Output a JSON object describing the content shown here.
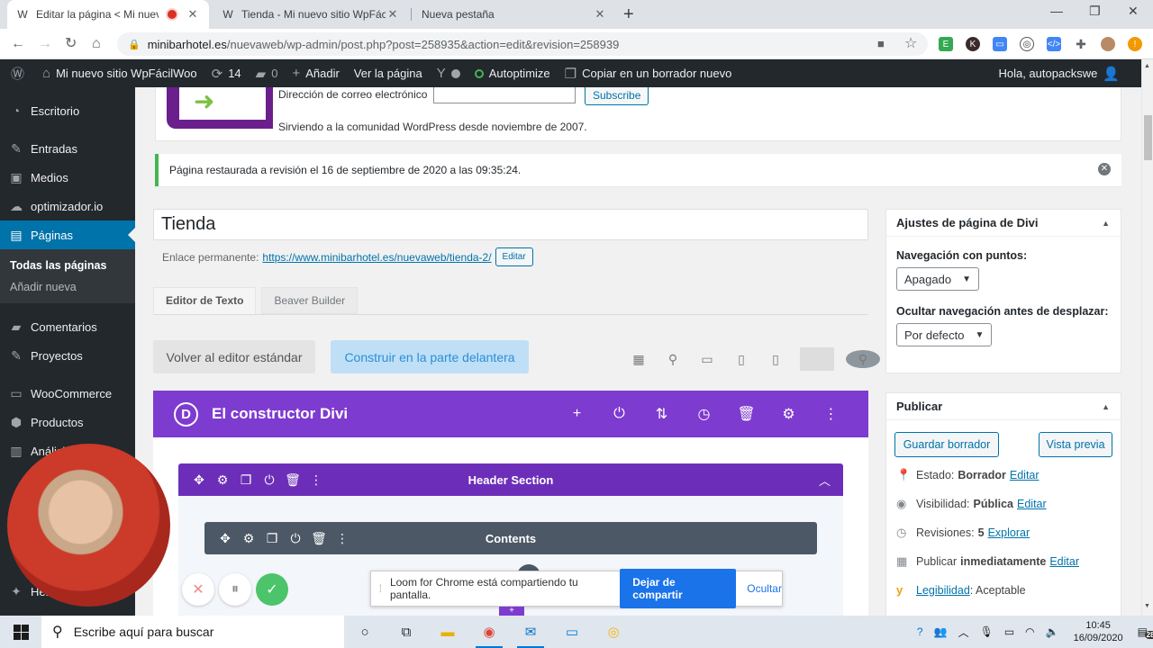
{
  "browser": {
    "tabs": [
      {
        "title": "Editar la página < Mi nuevo",
        "active": true
      },
      {
        "title": "Tienda - Mi nuevo sitio WpFácilW",
        "active": false
      },
      {
        "title": "Nueva pestaña",
        "active": false
      }
    ],
    "url_host": "minibarhotel.es",
    "url_path": "/nuevaweb/wp-admin/post.php?post=258935&action=edit&revision=258939"
  },
  "adminbar": {
    "site_name": "Mi nuevo sitio WpFácilWoo",
    "updates_count": "14",
    "comments_count": "0",
    "add_new": "Añadir",
    "view_page": "Ver la página",
    "autoptimize": "Autoptimize",
    "copy_draft": "Copiar en un borrador nuevo",
    "greeting": "Hola, autopackswe"
  },
  "sidebar": {
    "items": [
      {
        "label": "Escritorio",
        "icon": "dashboard-icon"
      },
      {
        "label": "Entradas",
        "icon": "pin-icon"
      },
      {
        "label": "Medios",
        "icon": "media-icon"
      },
      {
        "label": "optimizador.io",
        "icon": "cloud-icon"
      },
      {
        "label": "Páginas",
        "icon": "pages-icon"
      },
      {
        "label": "Comentarios",
        "icon": "comment-icon"
      },
      {
        "label": "Proyectos",
        "icon": "pin-icon"
      },
      {
        "label": "WooCommerce",
        "icon": "woo-icon"
      },
      {
        "label": "Productos",
        "icon": "box-icon"
      },
      {
        "label": "Análisis",
        "icon": "chart-icon"
      },
      {
        "label": "Herramientas",
        "icon": "wrench-icon"
      }
    ],
    "submenu": [
      "Todas las páginas",
      "Añadir nueva"
    ]
  },
  "newsletter": {
    "email_label": "Dirección de correo electrónico",
    "subscribe": "Subscribe",
    "tagline": "Sirviendo a la comunidad WordPress desde noviembre de 2007."
  },
  "notice": {
    "text": "Página restaurada a revisión el 16 de septiembre de 2020 a las 09:35:24."
  },
  "post": {
    "title": "Tienda",
    "permalink_label": "Enlace permanente:",
    "permalink_url": "https://www.minibarhotel.es/nuevaweb/tienda-2/",
    "edit_label": "Editar"
  },
  "editor_tabs": [
    "Editor de Texto",
    "Beaver Builder"
  ],
  "buttons": {
    "standard_editor": "Volver al editor estándar",
    "front_builder": "Construir en la parte delantera"
  },
  "divi": {
    "logo": "D",
    "title": "El constructor Divi",
    "section_title": "Header Section",
    "row_title": "Contents"
  },
  "divi_settings": {
    "title": "Ajustes de página de Divi",
    "dot_nav_label": "Navegación con puntos:",
    "dot_nav_value": "Apagado",
    "hide_nav_label": "Ocultar navegación antes de desplazar:",
    "hide_nav_value": "Por defecto"
  },
  "publish": {
    "title": "Publicar",
    "save_draft": "Guardar borrador",
    "preview": "Vista previa",
    "status_label": "Estado:",
    "status_value": "Borrador",
    "visibility_label": "Visibilidad:",
    "visibility_value": "Pública",
    "revisions_label": "Revisiones:",
    "revisions_value": "5",
    "explore": "Explorar",
    "publish_label": "Publicar",
    "publish_value": "inmediatamente",
    "readability_label": "Legibilidad",
    "readability_value": ": Aceptable",
    "edit": "Editar"
  },
  "loom": {
    "message": "Loom for Chrome está compartiendo tu pantalla.",
    "stop": "Dejar de compartir",
    "hide": "Ocultar"
  },
  "taskbar": {
    "search_placeholder": "Escribe aquí para buscar",
    "time": "10:45",
    "date": "16/09/2020",
    "notifications": "28"
  },
  "colors": {
    "wp_dark": "#23282d",
    "wp_blue": "#0073aa",
    "divi_purple": "#7e3bd0",
    "section_purple": "#6c2eb9",
    "row_gray": "#4c5866",
    "notice_green": "#46b450"
  }
}
